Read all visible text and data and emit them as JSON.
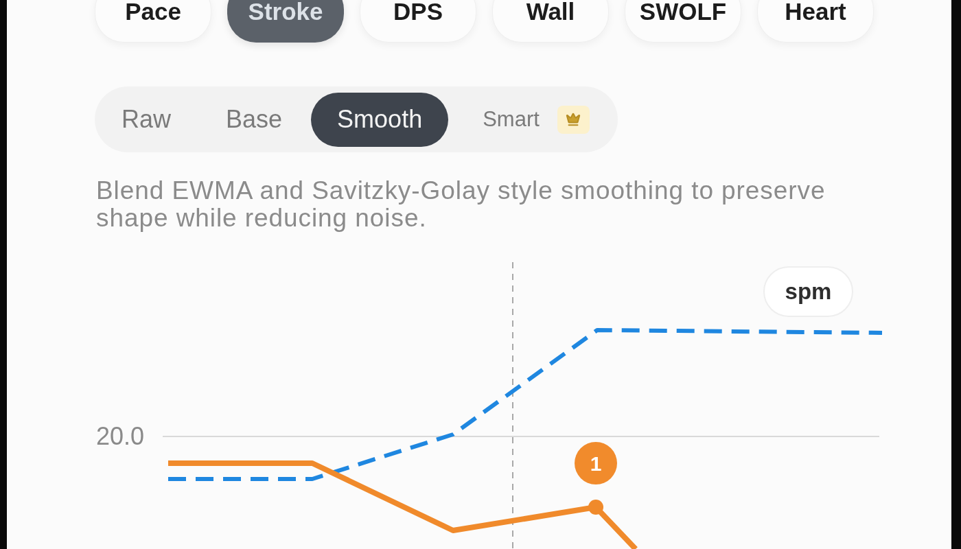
{
  "metric_tabs": [
    {
      "label": "Pace",
      "selected": false
    },
    {
      "label": "Stroke",
      "selected": true
    },
    {
      "label": "DPS",
      "selected": false
    },
    {
      "label": "Wall",
      "selected": false
    },
    {
      "label": "SWOLF",
      "selected": false
    },
    {
      "label": "Heart",
      "selected": false
    }
  ],
  "smoothing_modes": [
    {
      "label": "Raw",
      "selected": false,
      "kind": "standard"
    },
    {
      "label": "Base",
      "selected": false,
      "kind": "standard"
    },
    {
      "label": "Smooth",
      "selected": true,
      "kind": "standard"
    },
    {
      "label": "Smart",
      "selected": false,
      "kind": "premium"
    }
  ],
  "description": "Blend EWMA and Savitzky-Golay style smoothing to preserve shape while reducing noise.",
  "chart": {
    "unit": "spm",
    "y_tick_label": "20.0",
    "marker_label": "1"
  }
}
